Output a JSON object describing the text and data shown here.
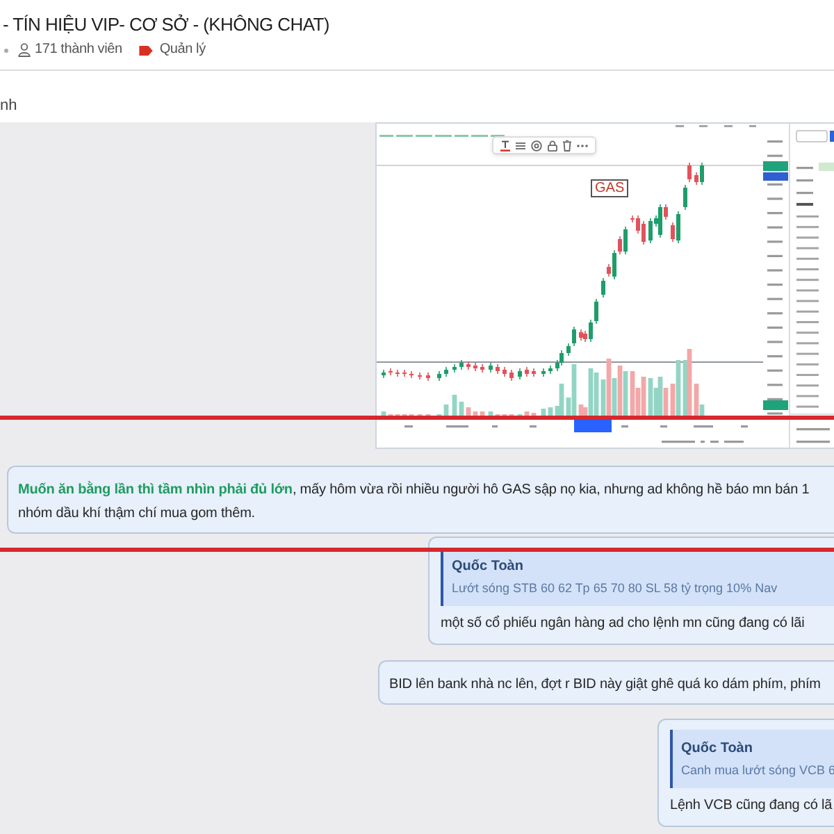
{
  "header": {
    "title": "- TÍN HIỆU VIP- CƠ SỞ - (KHÔNG CHAT)",
    "member_count": "171 thành viên",
    "role": "Quản lý"
  },
  "section_label": "nh",
  "messages": [
    {
      "kind": "image",
      "chart_label": "GAS"
    },
    {
      "kind": "text",
      "lines": [
        "**Muốn ăn bằng lần thì tầm nhìn phải đủ lớn**, mấy hôm vừa rồi nhiều người hô GAS sập nọ kia, nhưng ad không hề báo mn bán 1",
        "nhóm dầu khí thậm chí mua gom thêm."
      ]
    },
    {
      "kind": "reply",
      "quote": {
        "author": "Quốc Toàn",
        "text": "Lướt sóng STB 60 62 Tp 65 70 80 SL 58 tỷ trọng 10% Nav"
      },
      "lines": [
        "một số cổ phiếu ngân hàng ad cho lệnh mn cũng đang có lãi"
      ]
    },
    {
      "kind": "text",
      "lines": [
        "BID lên bank nhà nc lên, đợt r BID này giật ghê quá ko dám phím, phím"
      ]
    },
    {
      "kind": "reply",
      "quote": {
        "author": "Quốc Toàn",
        "text": "Canh mua lướt sóng VCB 6"
      },
      "lines": [
        "Lệnh VCB cũng đang có lã"
      ]
    }
  ]
}
